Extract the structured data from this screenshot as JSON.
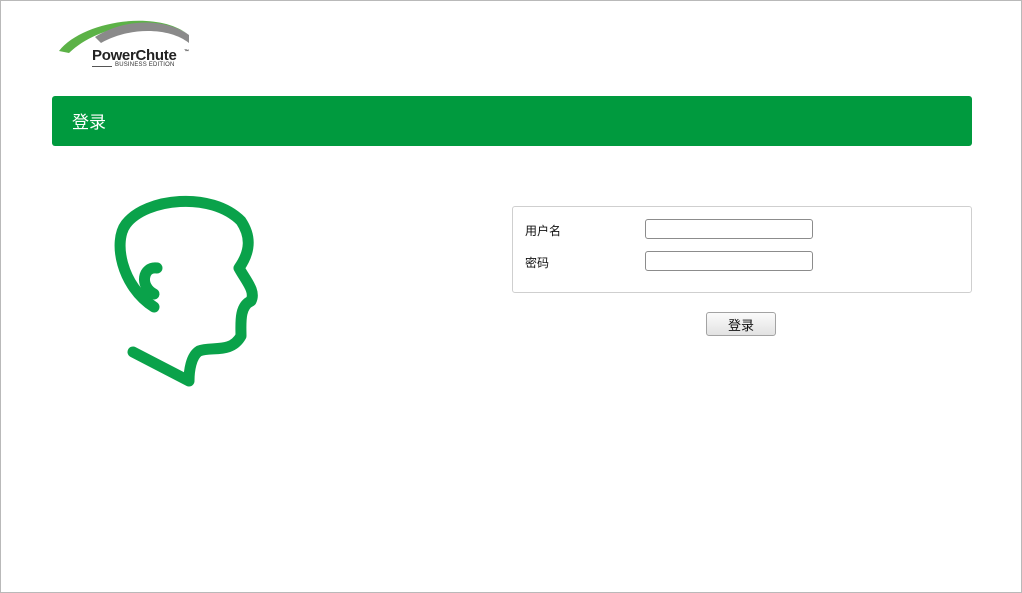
{
  "logo": {
    "name": "PowerChute",
    "trademark": "™",
    "edition": "BUSINESS EDITION"
  },
  "header": {
    "title": "登录"
  },
  "illustration": {
    "icon": "user-head-profile-icon",
    "color": "#0aa24a"
  },
  "form": {
    "username_label": "用户名",
    "username_value": "",
    "password_label": "密码",
    "password_value": "",
    "submit_label": "登录"
  },
  "colors": {
    "brand_green": "#009a3e",
    "logo_green": "#5cb247",
    "logo_gray": "#8a8a8a"
  }
}
